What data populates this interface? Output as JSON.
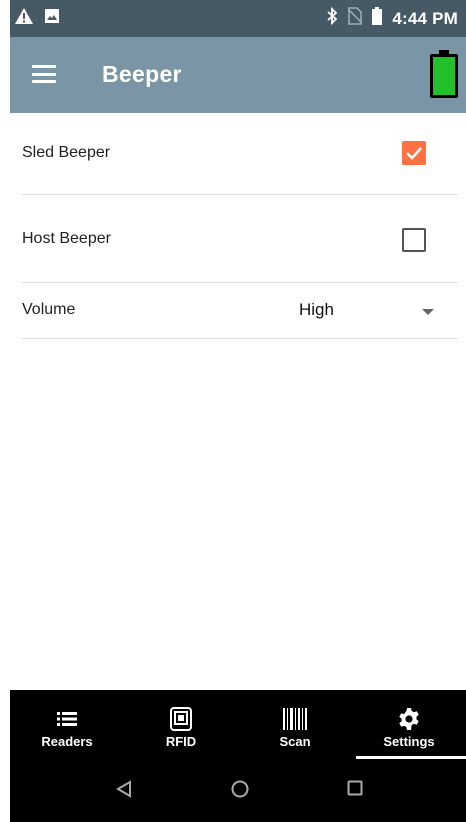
{
  "status_bar": {
    "time": "4:44 PM",
    "left_icons": [
      "warning-icon",
      "image-icon"
    ],
    "right_icons": [
      "bluetooth-icon",
      "no-sim-icon",
      "phone-battery-icon"
    ]
  },
  "app_bar": {
    "title": "Beeper",
    "menu_icon": "menu-icon",
    "battery_icon": "battery-full-icon",
    "background": "#7a95a6"
  },
  "settings": {
    "sled_beeper": {
      "label": "Sled Beeper",
      "checked": true
    },
    "host_beeper": {
      "label": "Host Beeper",
      "checked": false
    },
    "volume": {
      "label": "Volume",
      "value": "High"
    }
  },
  "bottom_nav": {
    "items": [
      {
        "label": "Readers",
        "icon": "list-icon",
        "selected": false
      },
      {
        "label": "RFID",
        "icon": "rfid-icon",
        "selected": false
      },
      {
        "label": "Scan",
        "icon": "barcode-icon",
        "selected": false
      },
      {
        "label": "Settings",
        "icon": "gear-icon",
        "selected": true
      }
    ]
  },
  "system_nav": {
    "buttons": [
      "back-icon",
      "home-icon",
      "recents-icon"
    ]
  },
  "colors": {
    "accent": "#ff7043",
    "status_bar": "#455a64",
    "battery": "#22c02a"
  }
}
